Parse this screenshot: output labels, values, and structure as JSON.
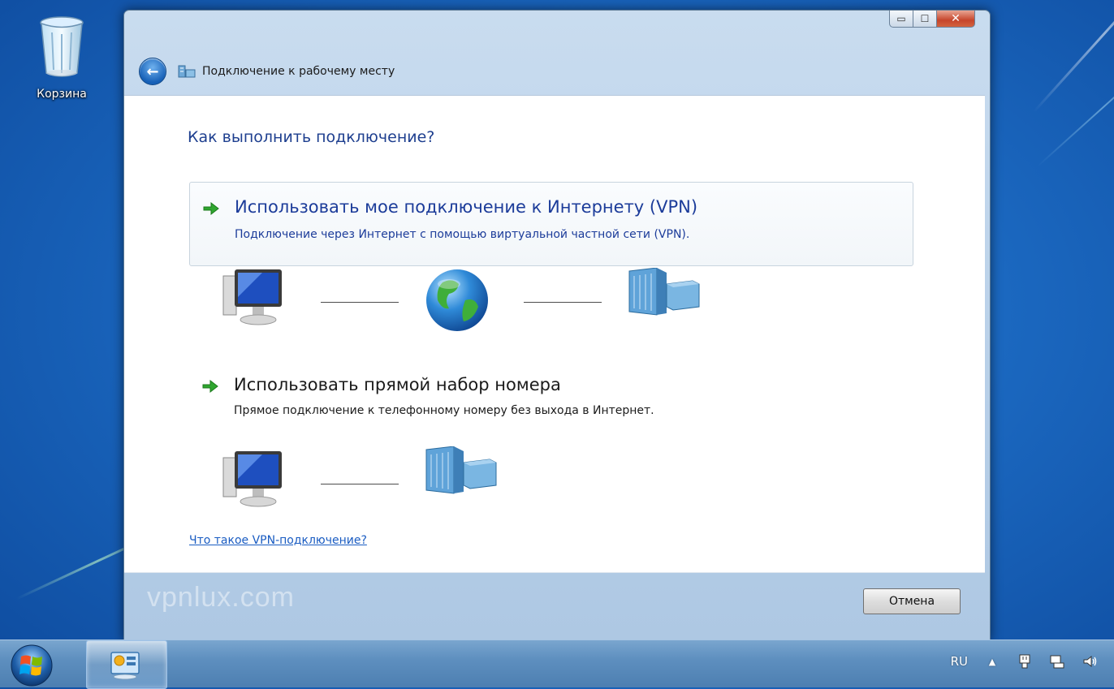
{
  "desktop": {
    "recycle_bin_label": "Корзина"
  },
  "window": {
    "title": "Подключение к рабочему месту",
    "heading": "Как выполнить подключение?",
    "options": [
      {
        "title": "Использовать мое подключение к Интернету (VPN)",
        "description": "Подключение через Интернет с помощью виртуальной частной сети (VPN)."
      },
      {
        "title": "Использовать прямой набор номера",
        "description": "Прямое подключение к телефонному номеру без выхода в Интернет."
      }
    ],
    "help_link": "Что такое VPN-подключение?",
    "watermark": "vpnlux.com",
    "cancel_label": "Отмена",
    "controls": {
      "minimize": "▭",
      "maximize": "☐",
      "close": "✕"
    }
  },
  "taskbar": {
    "language": "RU",
    "tray_arrow": "▲"
  },
  "colors": {
    "heading": "#1e3f8f",
    "link": "#1a5cc2",
    "desktop": "#1b68c0"
  }
}
